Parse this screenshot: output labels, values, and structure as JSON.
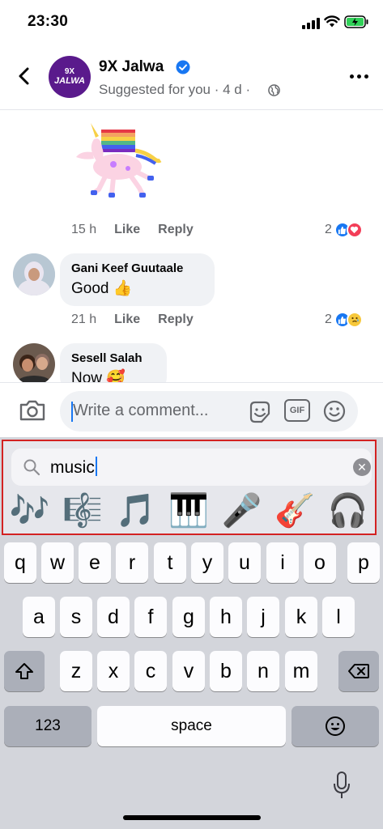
{
  "status": {
    "time": "23:30"
  },
  "header": {
    "avatar_top": "9X",
    "avatar_bottom": "JALWA",
    "page_name": "9X Jalwa",
    "subtitle": "Suggested for you · 4 d ·"
  },
  "comments": [
    {
      "time": "15 h",
      "like": "Like",
      "reply": "Reply",
      "reaction_count": "2"
    },
    {
      "author": "Gani Keef Guutaale",
      "text": "Good 👍",
      "time": "21 h",
      "like": "Like",
      "reply": "Reply",
      "reaction_count": "2"
    },
    {
      "author": "Sesell Salah",
      "text": "Now 🥰"
    }
  ],
  "composer": {
    "placeholder": "Write a comment...",
    "gif_label": "GIF"
  },
  "emoji_search": {
    "query": "music",
    "results": [
      "🎶",
      "🎼",
      "🎵",
      "🎹",
      "🎤",
      "🎸",
      "🎧"
    ]
  },
  "keyboard": {
    "row1": [
      "q",
      "w",
      "e",
      "r",
      "t",
      "y",
      "u",
      "i",
      "o",
      "p"
    ],
    "row2": [
      "a",
      "s",
      "d",
      "f",
      "g",
      "h",
      "j",
      "k",
      "l"
    ],
    "row3": [
      "z",
      "x",
      "c",
      "v",
      "b",
      "n",
      "m"
    ],
    "numbers_label": "123",
    "space_label": "space"
  },
  "colors": {
    "accent": "#1877f2",
    "highlight_border": "#d32222",
    "keyboard_bg": "#d3d5db"
  }
}
